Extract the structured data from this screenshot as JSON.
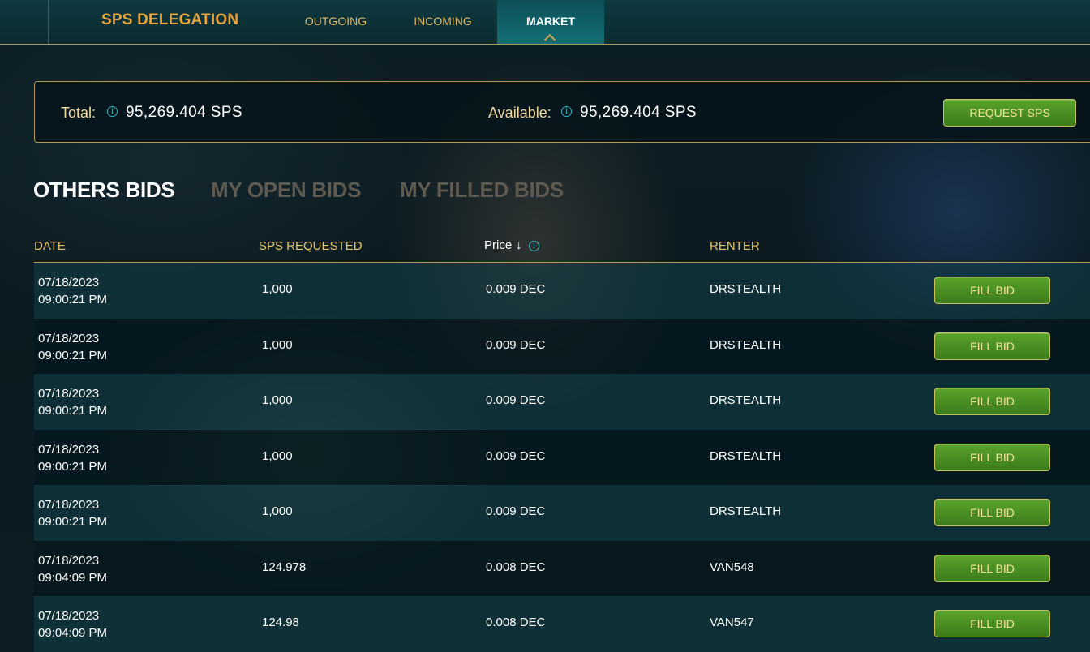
{
  "nav": {
    "brand": "SPS DELEGATION",
    "tabs": [
      {
        "label": "OUTGOING"
      },
      {
        "label": "INCOMING"
      },
      {
        "label": "MARKET"
      }
    ]
  },
  "summary": {
    "total_label": "Total:",
    "total_value": "95,269.404 SPS",
    "available_label": "Available:",
    "available_value": "95,269.404 SPS",
    "request_button": "REQUEST SPS"
  },
  "bid_tabs": [
    {
      "label": "OTHERS BIDS"
    },
    {
      "label": "MY OPEN BIDS"
    },
    {
      "label": "MY FILLED BIDS"
    }
  ],
  "table": {
    "headers": {
      "date": "DATE",
      "sps": "SPS REQUESTED",
      "price": "Price",
      "renter": "RENTER"
    },
    "rows": [
      {
        "date": "07/18/2023",
        "time": "09:00:21 PM",
        "sps": "1,000",
        "price": "0.009 DEC",
        "renter": "DRSTEALTH",
        "action": "FILL BID"
      },
      {
        "date": "07/18/2023",
        "time": "09:00:21 PM",
        "sps": "1,000",
        "price": "0.009 DEC",
        "renter": "DRSTEALTH",
        "action": "FILL BID"
      },
      {
        "date": "07/18/2023",
        "time": "09:00:21 PM",
        "sps": "1,000",
        "price": "0.009 DEC",
        "renter": "DRSTEALTH",
        "action": "FILL BID"
      },
      {
        "date": "07/18/2023",
        "time": "09:00:21 PM",
        "sps": "1,000",
        "price": "0.009 DEC",
        "renter": "DRSTEALTH",
        "action": "FILL BID"
      },
      {
        "date": "07/18/2023",
        "time": "09:00:21 PM",
        "sps": "1,000",
        "price": "0.009 DEC",
        "renter": "DRSTEALTH",
        "action": "FILL BID"
      },
      {
        "date": "07/18/2023",
        "time": "09:04:09 PM",
        "sps": "124.978",
        "price": "0.008 DEC",
        "renter": "VAN548",
        "action": "FILL BID"
      },
      {
        "date": "07/18/2023",
        "time": "09:04:09 PM",
        "sps": "124.98",
        "price": "0.008 DEC",
        "renter": "VAN547",
        "action": "FILL BID"
      }
    ]
  },
  "icons": {
    "info": "info-icon",
    "sort": "sort-down-arrow-icon",
    "active_tab": "chevron-up-icon"
  },
  "colors": {
    "accent_gold": "#e8a43a",
    "button_green": "#4a8f22",
    "info_teal": "#2fb8c0"
  }
}
